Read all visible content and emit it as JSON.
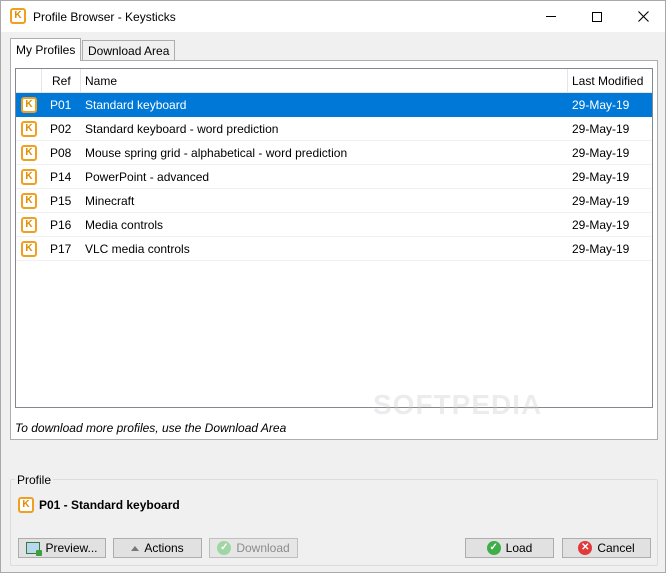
{
  "window": {
    "title": "Profile Browser - Keysticks",
    "app_icon_letter": "K"
  },
  "tabs": [
    {
      "label": "My Profiles",
      "active": true
    },
    {
      "label": "Download Area",
      "active": false
    }
  ],
  "grid": {
    "columns": [
      "Ref",
      "Name",
      "Last Modified"
    ],
    "selected_index": 0,
    "rows": [
      {
        "icon": "K",
        "ref": "P01",
        "name": "Standard keyboard",
        "modified": "29-May-19"
      },
      {
        "icon": "K",
        "ref": "P02",
        "name": "Standard keyboard - word prediction",
        "modified": "29-May-19"
      },
      {
        "icon": "K",
        "ref": "P08",
        "name": "Mouse spring grid - alphabetical - word prediction",
        "modified": "29-May-19"
      },
      {
        "icon": "K",
        "ref": "P14",
        "name": "PowerPoint - advanced",
        "modified": "29-May-19"
      },
      {
        "icon": "K",
        "ref": "P15",
        "name": "Minecraft",
        "modified": "29-May-19"
      },
      {
        "icon": "K",
        "ref": "P16",
        "name": "Media controls",
        "modified": "29-May-19"
      },
      {
        "icon": "K",
        "ref": "P17",
        "name": "VLC media controls",
        "modified": "29-May-19"
      }
    ]
  },
  "hint": "To download more profiles, use the Download Area",
  "watermark": "SOFTPEDIA",
  "profile_group": {
    "label": "Profile",
    "icon": "K",
    "current": "P01 - Standard keyboard"
  },
  "buttons": {
    "preview": "Preview...",
    "actions": "Actions",
    "download": "Download",
    "load": "Load",
    "cancel": "Cancel"
  },
  "colors": {
    "selection": "#0078d7",
    "app_icon": "#f0a020"
  }
}
